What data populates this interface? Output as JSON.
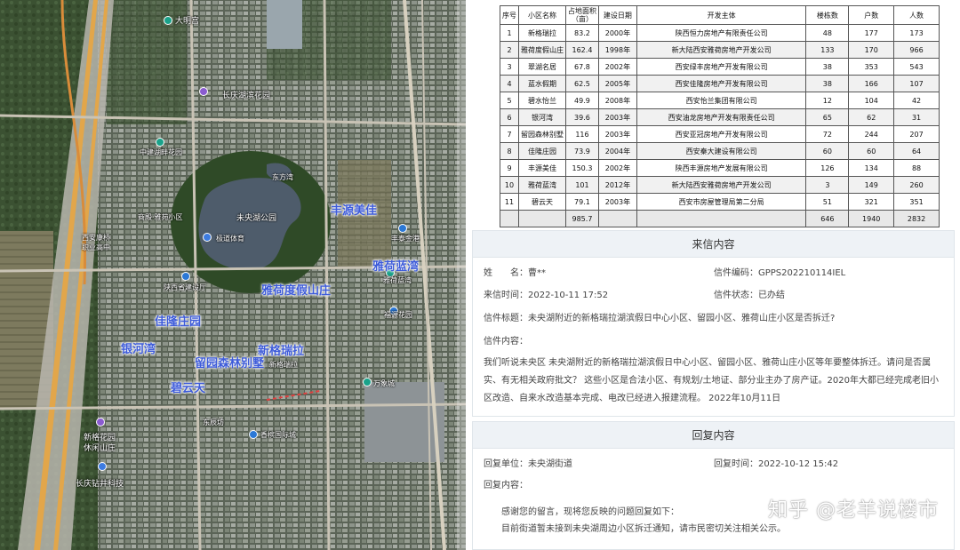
{
  "map": {
    "park_name": "未央湖公园",
    "highlight_labels": [
      {
        "id": "fengyuan",
        "text": "丰源美佳"
      },
      {
        "id": "yahe-lanwan",
        "text": "雅荷蓝湾"
      },
      {
        "id": "yahe-dujia",
        "text": "雅荷度假山庄"
      },
      {
        "id": "jialong",
        "text": "佳隆庄园"
      },
      {
        "id": "yinhewan",
        "text": "银河湾"
      },
      {
        "id": "xingelaila",
        "text": "新格瑞拉"
      },
      {
        "id": "liuyuan",
        "text": "留园森林别墅"
      },
      {
        "id": "biyuntian",
        "text": "碧云天"
      }
    ],
    "poi_labels": [
      {
        "id": "daming",
        "text": "大明宫"
      },
      {
        "id": "changqing",
        "text": "长庆湖滨花园"
      },
      {
        "id": "zhongjian",
        "text": "中建湖畔花园"
      },
      {
        "id": "dongfang",
        "text": "东方湾"
      },
      {
        "id": "xian-kangqiao",
        "text": "西安康桥\n职业高中"
      },
      {
        "id": "jidao",
        "text": "极道体育"
      },
      {
        "id": "yunhua",
        "text": "商殿·雅苑小区"
      },
      {
        "id": "shanxi-sheng",
        "text": "陕西省建设厅"
      },
      {
        "id": "yahe-sm",
        "text": "雅荷蓝湾"
      },
      {
        "id": "fuyuan",
        "text": "福源花园"
      },
      {
        "id": "wanxiang",
        "text": "万象城"
      },
      {
        "id": "xinge-sm",
        "text": "新格瑞拉"
      },
      {
        "id": "xingele",
        "text": "新格花园\n休闲山庄"
      },
      {
        "id": "changqing-jiao",
        "text": "长庆钻井科技"
      },
      {
        "id": "xiangbao",
        "text": "香槟国际城"
      },
      {
        "id": "dongchen",
        "text": "东辰坊"
      },
      {
        "id": "fengtai",
        "text": "丰泰金港"
      }
    ]
  },
  "table": {
    "headers": [
      "序号",
      "小区名称",
      "占地面积\n（亩）",
      "建设日期",
      "开发主体",
      "楼栋数",
      "户数",
      "人数"
    ],
    "rows": [
      [
        "1",
        "新格瑞拉",
        "83.2",
        "2000年",
        "陕西恒力房地产有限责任公司",
        "48",
        "177",
        "173"
      ],
      [
        "2",
        "雅荷度假山庄",
        "162.4",
        "1998年",
        "新大陆西安雅荷房地产开发公司",
        "133",
        "170",
        "966"
      ],
      [
        "3",
        "翠湖名居",
        "67.8",
        "2002年",
        "西安绿丰房地产开发有限公司",
        "38",
        "353",
        "543"
      ],
      [
        "4",
        "蓝水假期",
        "62.5",
        "2005年",
        "西安佳隆房地产开发有限公司",
        "38",
        "166",
        "107"
      ],
      [
        "5",
        "碧水怡兰",
        "49.9",
        "2008年",
        "西安怡兰集团有限公司",
        "12",
        "104",
        "42"
      ],
      [
        "6",
        "银河湾",
        "39.6",
        "2003年",
        "西安油龙房地产开发有限责任公司",
        "65",
        "62",
        "31"
      ],
      [
        "7",
        "留园森林别墅",
        "116",
        "2003年",
        "西安亚冠房地产开发有限公司",
        "72",
        "244",
        "207"
      ],
      [
        "8",
        "佳隆庄园",
        "73.9",
        "2004年",
        "西安秦大建设有限公司",
        "60",
        "60",
        "64"
      ],
      [
        "9",
        "丰源美佳",
        "150.3",
        "2002年",
        "陕西丰源房地产发展有限公司",
        "126",
        "134",
        "88"
      ],
      [
        "10",
        "雅荷蓝湾",
        "101",
        "2012年",
        "新大陆西安雅荷房地产开发公司",
        "3",
        "149",
        "260"
      ],
      [
        "11",
        "碧云天",
        "79.1",
        "2003年",
        "西安市房屋管理局第二分局",
        "51",
        "321",
        "351"
      ]
    ],
    "total": [
      "",
      "",
      "985.7",
      "",
      "",
      "646",
      "1940",
      "2832"
    ]
  },
  "letter": {
    "title": "来信内容",
    "name_label": "姓　　名：",
    "name_value": "曹**",
    "code_label": "信件编码：",
    "code_value": "GPPS202210114IEL",
    "time_label": "来信时间：",
    "time_value": "2022-10-11 17:52",
    "status_label": "信件状态：",
    "status_value": "已办结",
    "subject_label": "信件标题：",
    "subject_value": "未央湖附近的新格瑞拉湖滨假日中心小区、留园小区、雅荷山庄小区是否拆迁?",
    "content_label": "信件内容：",
    "content_value": "我们听说未央区 未央湖附近的新格瑞拉湖滨假日中心小区、留园小区、雅荷山庄小区等年要整体拆迁。请问是否属实、有无相关政府批文？ 这些小区是合法小区、有规划/土地证、部分业主办了房产证。2020年大都已经完成老旧小区改造、自来水改造基本完成、电改已经进入报建流程。 2022年10月11日"
  },
  "reply": {
    "title": "回复内容",
    "unit_label": "回复单位：",
    "unit_value": "未央湖街道",
    "time_label": "回复时间：",
    "time_value": "2022-10-12 15:42",
    "content_label": "回复内容：",
    "line1": "感谢您的留言，现将您反映的问题回复如下：",
    "line2": "目前街道暂未接到未央湖周边小区拆迁通知，请市民密切关注相关公示。"
  },
  "watermark": "知乎 @老羊说楼市"
}
